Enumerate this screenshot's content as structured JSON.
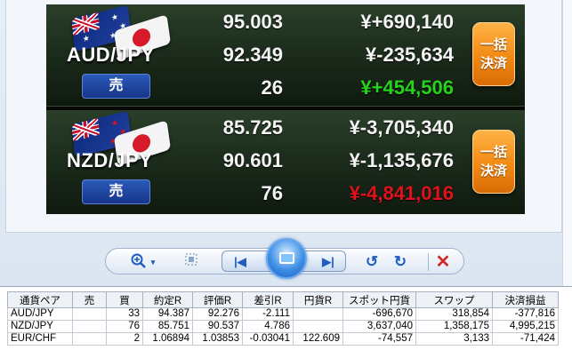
{
  "positions": [
    {
      "pair": "AUD/JPY",
      "side_label": "売",
      "rate_top": "95.003",
      "rate_mid": "92.349",
      "quantity": "26",
      "pl_top": "¥+690,140",
      "pl_mid": "¥-235,634",
      "pl_total": "¥+454,506",
      "pl_total_color": "#27d21f",
      "settle_label_line1": "一括",
      "settle_label_line2": "決済"
    },
    {
      "pair": "NZD/JPY",
      "side_label": "売",
      "rate_top": "85.725",
      "rate_mid": "90.601",
      "quantity": "76",
      "pl_top": "¥-3,705,340",
      "pl_mid": "¥-1,135,676",
      "pl_total": "¥-4,841,016",
      "pl_total_color": "#e0121c",
      "settle_label_line1": "一括",
      "settle_label_line2": "決済"
    }
  ],
  "toolbar": {
    "zoom_icon": "zoom-in-icon",
    "zoom_dropdown_icon": "chevron-down-icon",
    "fit_icon": "actual-size-icon",
    "prev_icon": "previous-icon",
    "slideshow_icon": "slideshow-icon",
    "next_icon": "next-icon",
    "rotate_ccw_icon": "rotate-left-icon",
    "rotate_cw_icon": "rotate-right-icon",
    "delete_icon": "delete-icon"
  },
  "table": {
    "headers": [
      "通貨ペア",
      "売",
      "買",
      "約定R",
      "評価R",
      "差引R",
      "円貨R",
      "スポット円貨",
      "スワップ",
      "決済損益"
    ],
    "rows": [
      [
        "AUD/JPY",
        "",
        "33",
        "94.387",
        "92.276",
        "-2.111",
        "",
        "-696,670",
        "318,854",
        "-377,816"
      ],
      [
        "NZD/JPY",
        "",
        "76",
        "85.751",
        "90.537",
        "4.786",
        "",
        "3,637,040",
        "1,358,175",
        "4,995,215"
      ],
      [
        "EUR/CHF",
        "",
        "2",
        "1.06894",
        "1.03853",
        "-0.03041",
        "122.609",
        "-74,557",
        "3,133",
        "-71,424"
      ]
    ]
  },
  "colors": {
    "profit_green": "#27d21f",
    "loss_red": "#e0121c",
    "settle_orange": "#f28a12",
    "sell_blue": "#17358a"
  }
}
